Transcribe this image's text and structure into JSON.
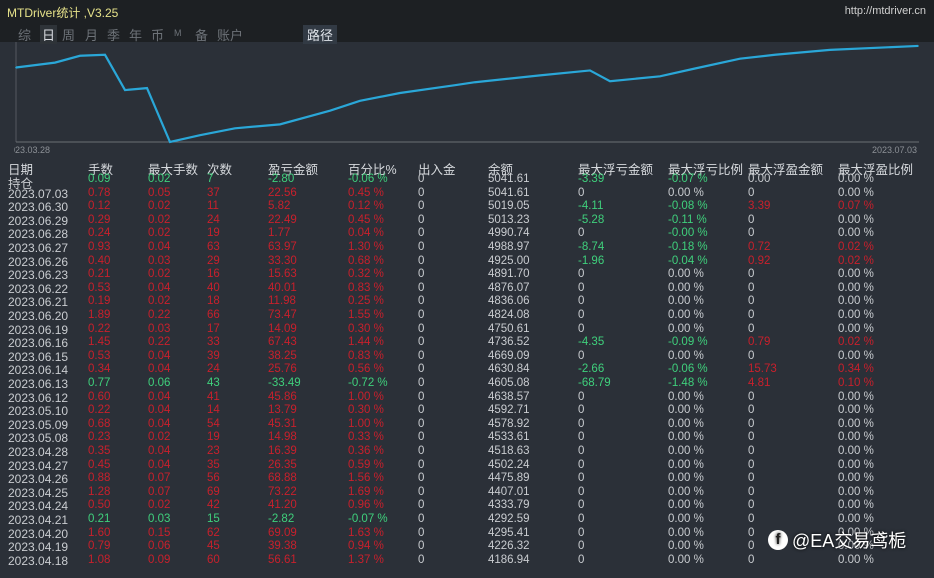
{
  "title": "MTDriver统计 ,V3.25",
  "url": "http://mtdriver.cn",
  "tabs": [
    "综",
    "日",
    "周",
    "月",
    "季",
    "年",
    "币",
    "M",
    "备",
    "账户"
  ],
  "active_tab": "日",
  "path_button": "路径",
  "chart_data": {
    "type": "line",
    "title": "",
    "x_start": "023.03.28",
    "x_end": "2023.07.03",
    "values": [
      76,
      81,
      88,
      89,
      53,
      55,
      0,
      7,
      14,
      18,
      32,
      42,
      50,
      58,
      61,
      68,
      73,
      62,
      67,
      75,
      85,
      89,
      94,
      98
    ]
  },
  "headers": [
    "日期",
    "手数",
    "最大手数",
    "次数",
    "盈亏金额",
    "百分比%",
    "出入金",
    "余额",
    "最大浮亏金额",
    "最大浮亏比例",
    "最大浮盈金额",
    "最大浮盈比例"
  ],
  "rows": [
    [
      "持仓",
      "0.09",
      "0.02",
      "7",
      "-2.80",
      "-0.06 %",
      "0",
      "5041.61",
      "-3.39",
      "-0.07 %",
      "0.00",
      "0.00 %"
    ],
    [
      "2023.07.03",
      "0.78",
      "0.05",
      "37",
      "22.56",
      "0.45 %",
      "0",
      "5041.61",
      "0",
      "0.00 %",
      "0",
      "0.00 %"
    ],
    [
      "2023.06.30",
      "0.12",
      "0.02",
      "11",
      "5.82",
      "0.12 %",
      "0",
      "5019.05",
      "-4.11",
      "-0.08 %",
      "3.39",
      "0.07 %"
    ],
    [
      "2023.06.29",
      "0.29",
      "0.02",
      "24",
      "22.49",
      "0.45 %",
      "0",
      "5013.23",
      "-5.28",
      "-0.11 %",
      "0",
      "0.00 %"
    ],
    [
      "2023.06.28",
      "0.24",
      "0.02",
      "19",
      "1.77",
      "0.04 %",
      "0",
      "4990.74",
      "0",
      "-0.00 %",
      "0",
      "0.00 %"
    ],
    [
      "2023.06.27",
      "0.93",
      "0.04",
      "63",
      "63.97",
      "1.30 %",
      "0",
      "4988.97",
      "-8.74",
      "-0.18 %",
      "0.72",
      "0.02 %"
    ],
    [
      "2023.06.26",
      "0.40",
      "0.03",
      "29",
      "33.30",
      "0.68 %",
      "0",
      "4925.00",
      "-1.96",
      "-0.04 %",
      "0.92",
      "0.02 %"
    ],
    [
      "2023.06.23",
      "0.21",
      "0.02",
      "16",
      "15.63",
      "0.32 %",
      "0",
      "4891.70",
      "0",
      "0.00 %",
      "0",
      "0.00 %"
    ],
    [
      "2023.06.22",
      "0.53",
      "0.04",
      "40",
      "40.01",
      "0.83 %",
      "0",
      "4876.07",
      "0",
      "0.00 %",
      "0",
      "0.00 %"
    ],
    [
      "2023.06.21",
      "0.19",
      "0.02",
      "18",
      "11.98",
      "0.25 %",
      "0",
      "4836.06",
      "0",
      "0.00 %",
      "0",
      "0.00 %"
    ],
    [
      "2023.06.20",
      "1.89",
      "0.22",
      "66",
      "73.47",
      "1.55 %",
      "0",
      "4824.08",
      "0",
      "0.00 %",
      "0",
      "0.00 %"
    ],
    [
      "2023.06.19",
      "0.22",
      "0.03",
      "17",
      "14.09",
      "0.30 %",
      "0",
      "4750.61",
      "0",
      "0.00 %",
      "0",
      "0.00 %"
    ],
    [
      "2023.06.16",
      "1.45",
      "0.22",
      "33",
      "67.43",
      "1.44 %",
      "0",
      "4736.52",
      "-4.35",
      "-0.09 %",
      "0.79",
      "0.02 %"
    ],
    [
      "2023.06.15",
      "0.53",
      "0.04",
      "39",
      "38.25",
      "0.83 %",
      "0",
      "4669.09",
      "0",
      "0.00 %",
      "0",
      "0.00 %"
    ],
    [
      "2023.06.14",
      "0.34",
      "0.04",
      "24",
      "25.76",
      "0.56 %",
      "0",
      "4630.84",
      "-2.66",
      "-0.06 %",
      "15.73",
      "0.34 %"
    ],
    [
      "2023.06.13",
      "0.77",
      "0.06",
      "43",
      "-33.49",
      "-0.72 %",
      "0",
      "4605.08",
      "-68.79",
      "-1.48 %",
      "4.81",
      "0.10 %"
    ],
    [
      "2023.06.12",
      "0.60",
      "0.04",
      "41",
      "45.86",
      "1.00 %",
      "0",
      "4638.57",
      "0",
      "0.00 %",
      "0",
      "0.00 %"
    ],
    [
      "2023.05.10",
      "0.22",
      "0.04",
      "14",
      "13.79",
      "0.30 %",
      "0",
      "4592.71",
      "0",
      "0.00 %",
      "0",
      "0.00 %"
    ],
    [
      "2023.05.09",
      "0.68",
      "0.04",
      "54",
      "45.31",
      "1.00 %",
      "0",
      "4578.92",
      "0",
      "0.00 %",
      "0",
      "0.00 %"
    ],
    [
      "2023.05.08",
      "0.23",
      "0.02",
      "19",
      "14.98",
      "0.33 %",
      "0",
      "4533.61",
      "0",
      "0.00 %",
      "0",
      "0.00 %"
    ],
    [
      "2023.04.28",
      "0.35",
      "0.04",
      "23",
      "16.39",
      "0.36 %",
      "0",
      "4518.63",
      "0",
      "0.00 %",
      "0",
      "0.00 %"
    ],
    [
      "2023.04.27",
      "0.45",
      "0.04",
      "35",
      "26.35",
      "0.59 %",
      "0",
      "4502.24",
      "0",
      "0.00 %",
      "0",
      "0.00 %"
    ],
    [
      "2023.04.26",
      "0.88",
      "0.07",
      "56",
      "68.88",
      "1.56 %",
      "0",
      "4475.89",
      "0",
      "0.00 %",
      "0",
      "0.00 %"
    ],
    [
      "2023.04.25",
      "1.28",
      "0.07",
      "69",
      "73.22",
      "1.69 %",
      "0",
      "4407.01",
      "0",
      "0.00 %",
      "0",
      "0.00 %"
    ],
    [
      "2023.04.24",
      "0.50",
      "0.02",
      "42",
      "41.20",
      "0.96 %",
      "0",
      "4333.79",
      "0",
      "0.00 %",
      "0",
      "0.00 %"
    ],
    [
      "2023.04.21",
      "0.21",
      "0.03",
      "15",
      "-2.82",
      "-0.07 %",
      "0",
      "4292.59",
      "0",
      "0.00 %",
      "0",
      "0.00 %"
    ],
    [
      "2023.04.20",
      "1.60",
      "0.15",
      "62",
      "69.09",
      "1.63 %",
      "0",
      "4295.41",
      "0",
      "0.00 %",
      "0",
      "0.00 %"
    ],
    [
      "2023.04.19",
      "0.79",
      "0.06",
      "45",
      "39.38",
      "0.94 %",
      "0",
      "4226.32",
      "0",
      "0.00 %",
      "0",
      "0.00 %"
    ],
    [
      "2023.04.18",
      "1.08",
      "0.09",
      "60",
      "56.61",
      "1.37 %",
      "0",
      "4186.94",
      "0",
      "0.00 %",
      "0",
      "0.00 %"
    ]
  ],
  "watermark": "@EA交易鸢栀",
  "colors": {
    "line": "#2aa7d8",
    "red": "#c8202c",
    "green": "#3fd07c"
  }
}
